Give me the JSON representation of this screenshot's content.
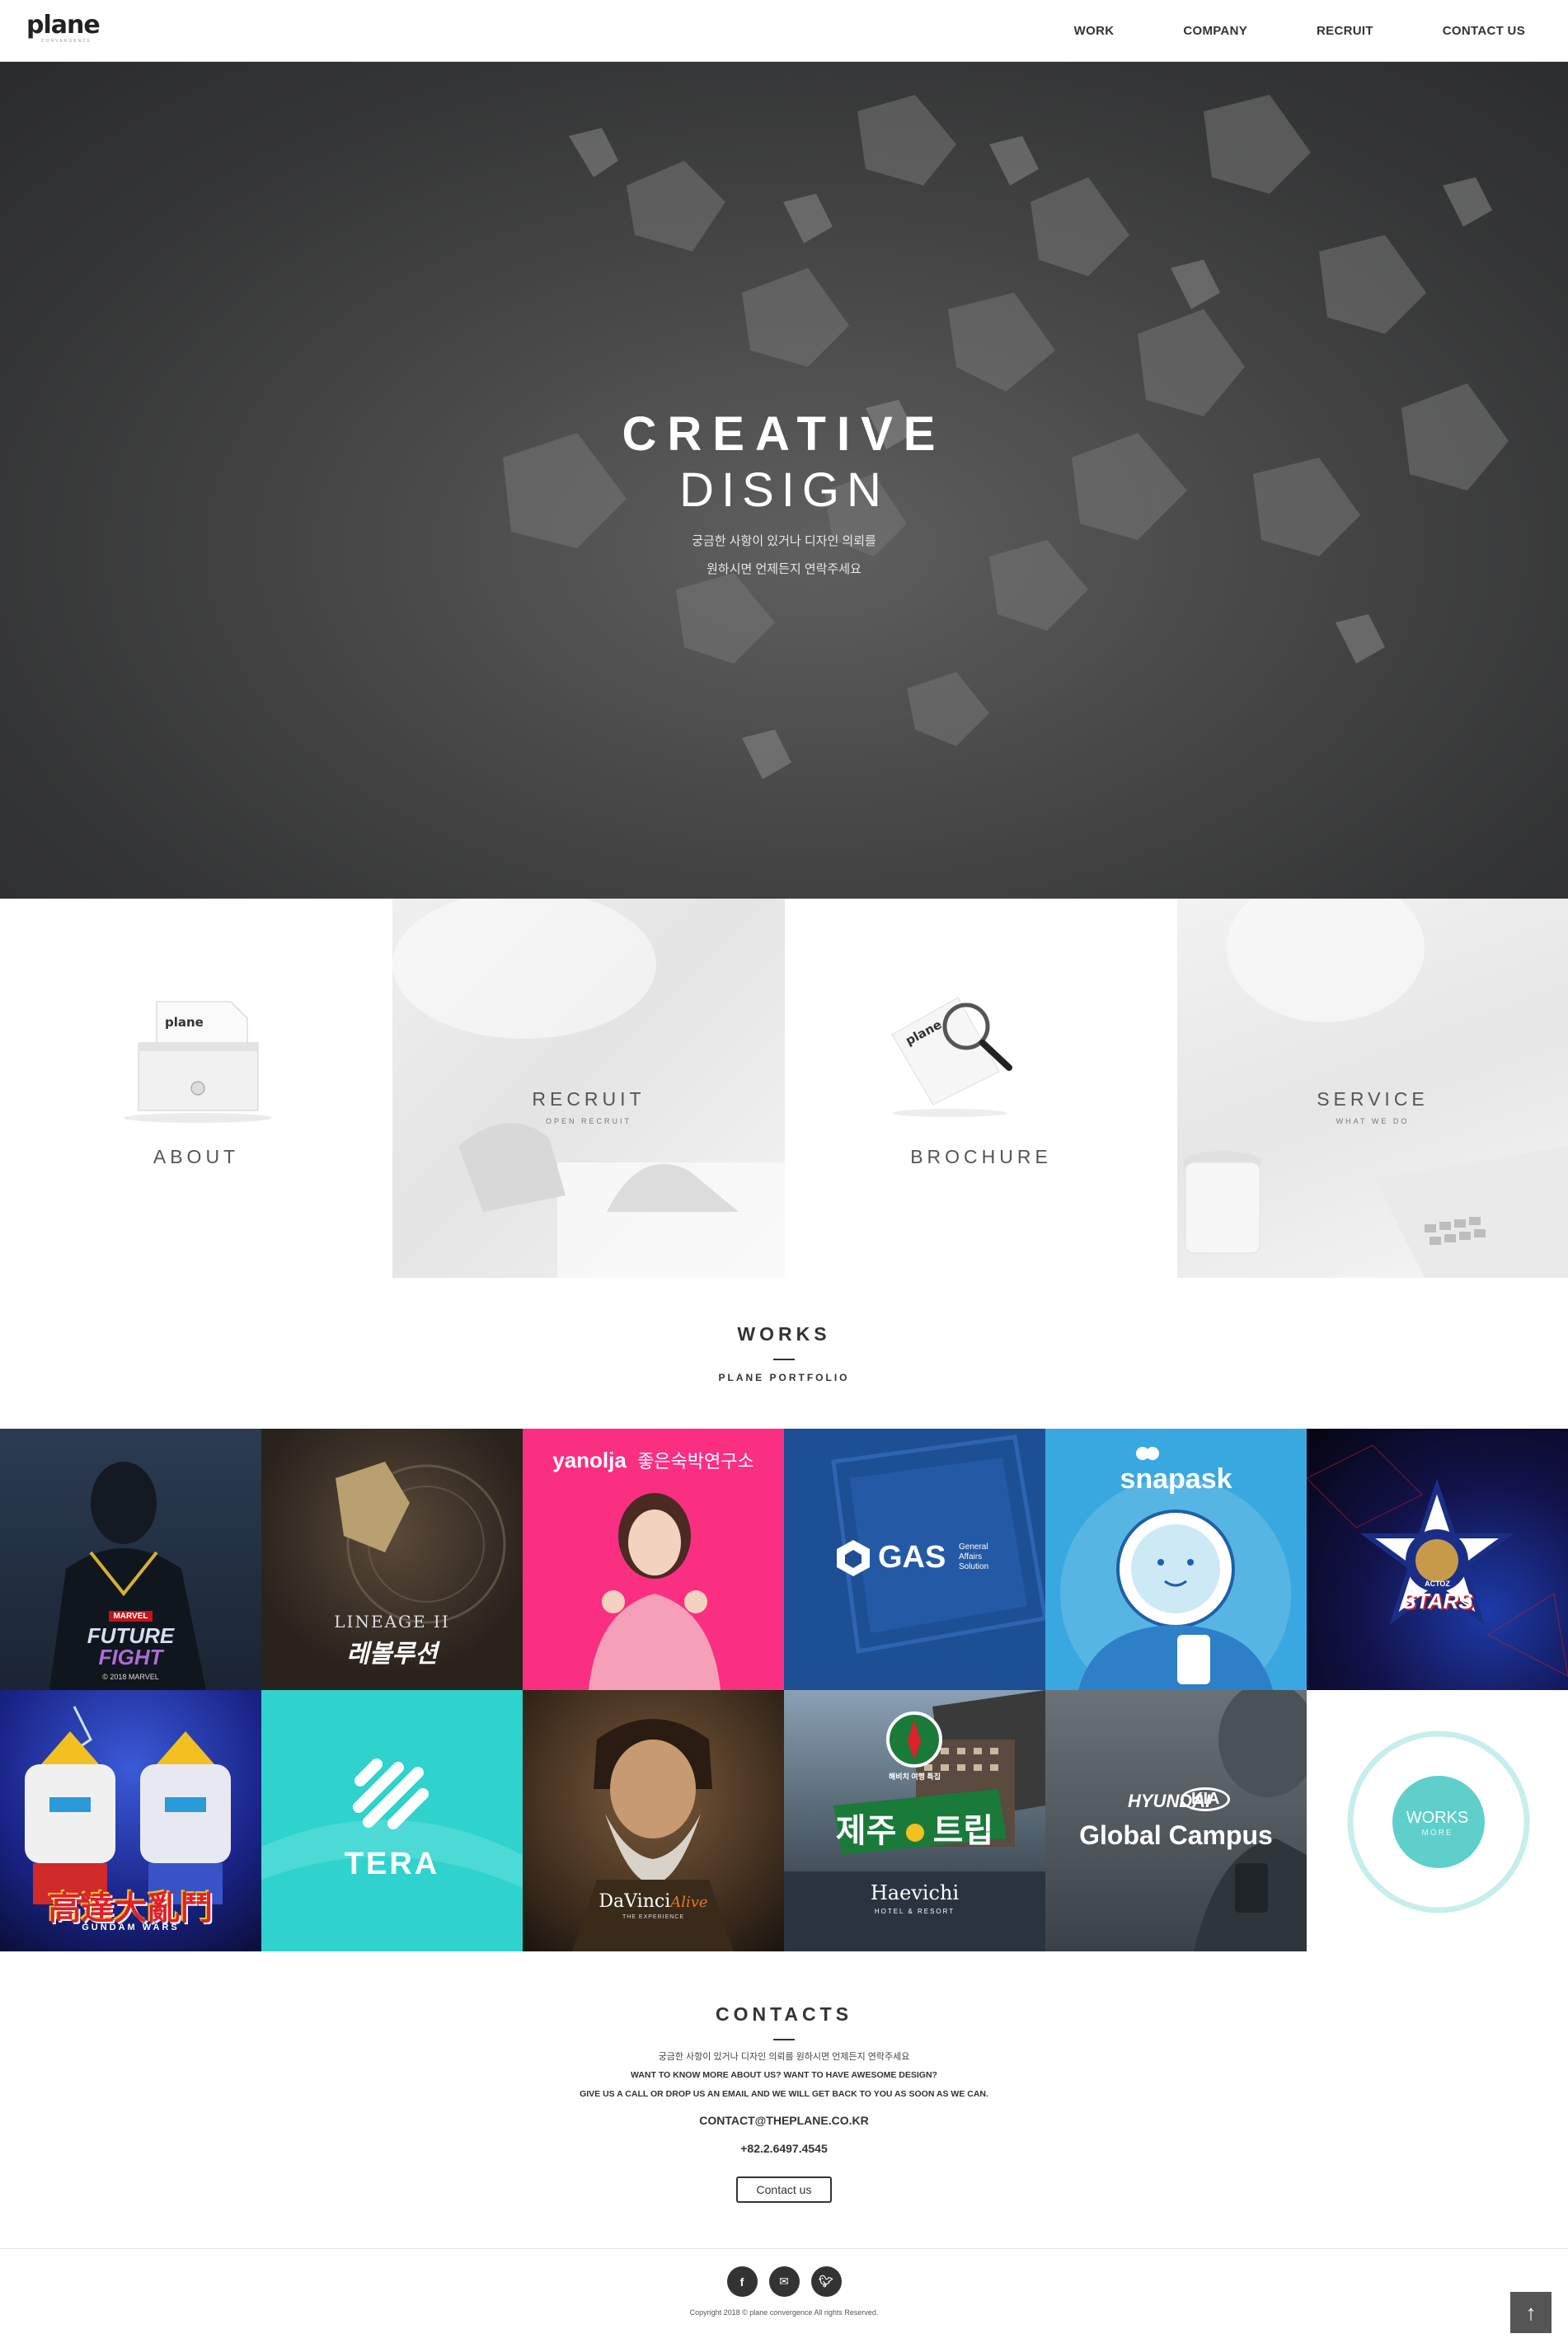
{
  "header": {
    "logo_text": "plane",
    "logo_sub": "CONVERGENCE",
    "nav": [
      "WORK",
      "COMPANY",
      "RECRUIT",
      "CONTACT US"
    ]
  },
  "hero": {
    "title_line1": "CREATIVE",
    "title_line2": "DISIGN",
    "subtitle_line1": "궁금한 사항이 있거나 디자인 의뢰를",
    "subtitle_line2": "원하시면 언제든지 연락주세요"
  },
  "quick_menu": {
    "about": "ABOUT",
    "recruit": "RECRUIT",
    "recruit_sub": "OPEN RECRUIT",
    "brochure": "BROCHURE",
    "service": "SERVICE",
    "service_sub": "WHAT WE DO",
    "paper_logo": "plane"
  },
  "works": {
    "title": "WORKS",
    "subtitle": "PLANE PORTFOLIO",
    "tiles": {
      "future_fight": {
        "brand": "MARVEL",
        "title1": "FUTURE",
        "title2": "FIGHT",
        "note": "© 2018 MARVEL"
      },
      "lineage": {
        "title": "LINEAGE II",
        "sub": "레볼루션"
      },
      "yanolja": {
        "brand": "yanolja",
        "tagline": "좋은숙박연구소"
      },
      "gas": {
        "title": "GAS",
        "sub1": "General",
        "sub2": "Affairs",
        "sub3": "Solution"
      },
      "snapask": {
        "title": "snapask"
      },
      "stars": {
        "small": "ACTOZ",
        "title": "STARS"
      },
      "gundam": {
        "title": "高達大亂鬥",
        "sub": "GUNDAM WARS"
      },
      "tera": {
        "title": "TERA"
      },
      "davinci": {
        "title": "DaVinci",
        "script": "Alive",
        "sub": "THE EXPERIENCE"
      },
      "haevichi": {
        "badge": "해비치 여행 특집",
        "title1": "제주",
        "title2": "트립",
        "brand": "Haevichi",
        "sub": "HOTEL & RESORT"
      },
      "global_campus": {
        "brand1": "HYUNDAI",
        "brand2": "KIA",
        "title": "Global Campus"
      },
      "more": {
        "label": "WORKS",
        "sub": "MORE"
      }
    }
  },
  "contacts": {
    "title": "CONTACTS",
    "line_kr": "궁금한 사항이 있거나 디자인 의뢰를 원하시면 언제든지 연락주세요",
    "line_en1": "WANT TO KNOW MORE ABOUT US? WANT TO HAVE AWESOME DESIGN?",
    "line_en2": "GIVE US A CALL OR DROP US AN EMAIL AND WE WILL GET BACK TO YOU AS SOON AS WE CAN.",
    "email": "CONTACT@THEPLANE.CO.KR",
    "phone": "+82.2.6497.4545",
    "button": "Contact us"
  },
  "footer": {
    "social": [
      "facebook-icon",
      "mail-icon",
      "twitter-icon"
    ],
    "copyright": "Copyright 2018 © plane convergence All rights Reserved."
  },
  "colors": {
    "accent_teal": "#5ecfcb",
    "yanolja_pink": "#fa2f82",
    "gas_blue": "#1d4f95",
    "snapask_blue": "#3aa8e0",
    "tera_teal": "#2fd2cc"
  }
}
